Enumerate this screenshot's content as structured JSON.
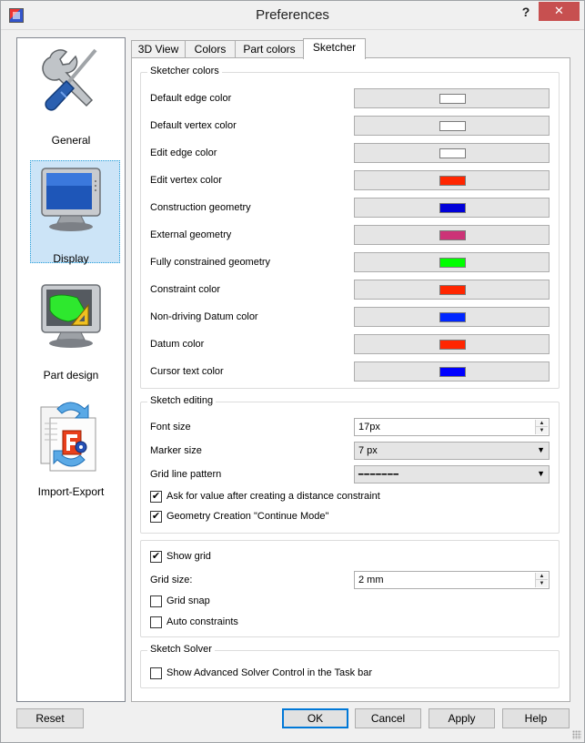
{
  "window": {
    "title": "Preferences",
    "help_glyph": "?",
    "close_glyph": "✕"
  },
  "categories": [
    {
      "label": "General",
      "icon": "tools-icon"
    },
    {
      "label": "Display",
      "icon": "monitor-icon",
      "selected": true
    },
    {
      "label": "Part design",
      "icon": "part-design-icon"
    },
    {
      "label": "Import-Export",
      "icon": "import-export-icon"
    }
  ],
  "tabs": [
    {
      "label": "3D View"
    },
    {
      "label": "Colors"
    },
    {
      "label": "Part colors"
    },
    {
      "label": "Sketcher",
      "active": true
    }
  ],
  "sketcher_colors": {
    "title": "Sketcher colors",
    "rows": [
      {
        "label": "Default edge color",
        "color": "#ffffff"
      },
      {
        "label": "Default vertex color",
        "color": "#ffffff"
      },
      {
        "label": "Edit edge color",
        "color": "#ffffff"
      },
      {
        "label": "Edit vertex color",
        "color": "#ff2600"
      },
      {
        "label": "Construction geometry",
        "color": "#0000d8"
      },
      {
        "label": "External geometry",
        "color": "#cc3377"
      },
      {
        "label": "Fully constrained geometry",
        "color": "#00ff00"
      },
      {
        "label": "Constraint color",
        "color": "#ff2600"
      },
      {
        "label": "Non-driving Datum color",
        "color": "#0026ff"
      },
      {
        "label": "Datum color",
        "color": "#ff2600"
      },
      {
        "label": "Cursor text color",
        "color": "#0000ff"
      }
    ]
  },
  "sketch_editing": {
    "title": "Sketch editing",
    "font_size_label": "Font size",
    "font_size_value": "17px",
    "marker_size_label": "Marker size",
    "marker_size_value": "7 px",
    "grid_line_pattern_label": "Grid line pattern",
    "grid_line_pattern_value": "━━━━━━━",
    "ask_value_label": "Ask for value after creating a distance constraint",
    "ask_value_checked": true,
    "continue_mode_label": "Geometry Creation \"Continue Mode\"",
    "continue_mode_checked": true
  },
  "grid": {
    "show_grid_label": "Show grid",
    "show_grid_checked": true,
    "grid_size_label": "Grid size:",
    "grid_size_value": "2 mm",
    "grid_snap_label": "Grid snap",
    "grid_snap_checked": false,
    "auto_constraints_label": "Auto constraints",
    "auto_constraints_checked": false
  },
  "sketch_solver": {
    "title": "Sketch Solver",
    "advanced_label": "Show Advanced Solver Control in the Task bar",
    "advanced_checked": false
  },
  "buttons": {
    "reset": "Reset",
    "ok": "OK",
    "cancel": "Cancel",
    "apply": "Apply",
    "help": "Help"
  },
  "glyphs": {
    "check": "✔",
    "spin_up": "▲",
    "spin_down": "▼",
    "dropdown": "▼"
  }
}
